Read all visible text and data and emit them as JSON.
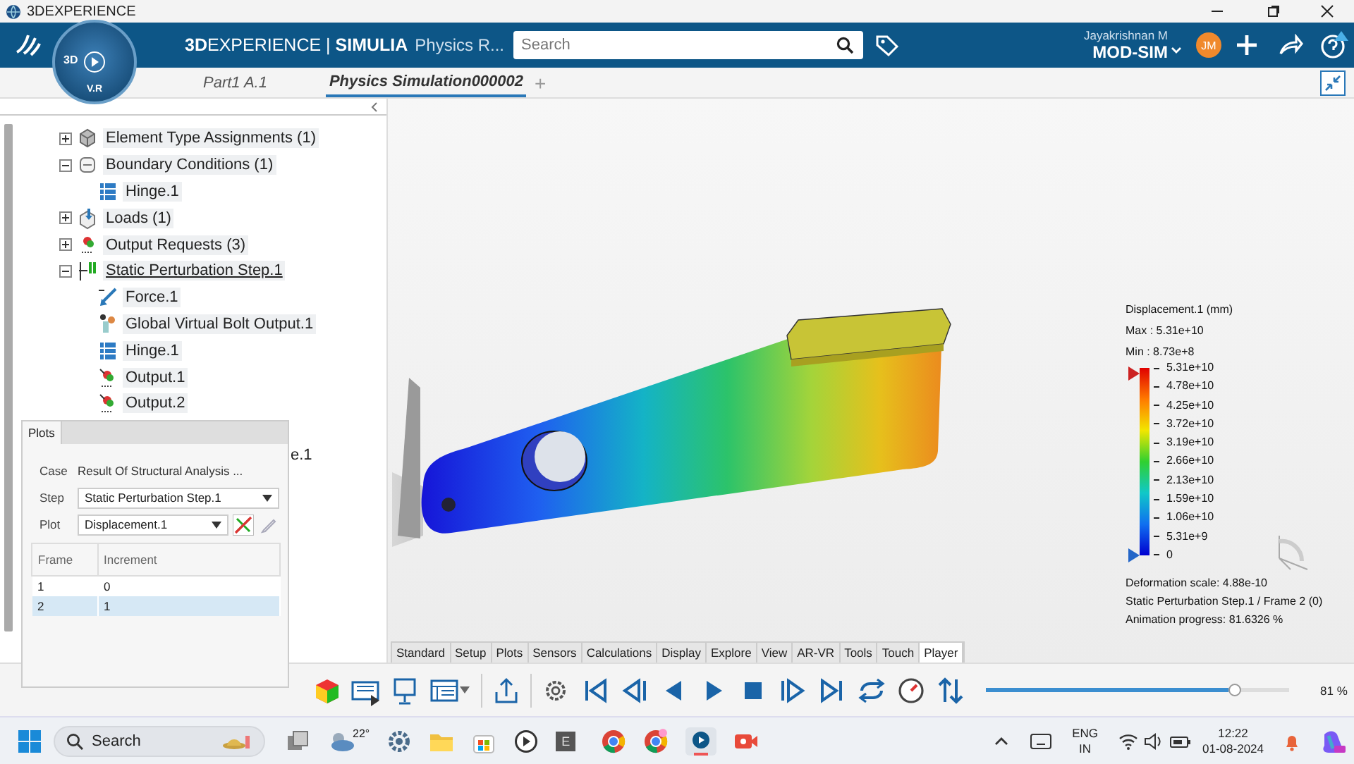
{
  "title_bar": {
    "title": "3DEXPERIENCE"
  },
  "header": {
    "brand": "**3D**EXPERIENCE | **SIMULIA**",
    "app": "Physics R...",
    "search": {
      "placeholder": "Search"
    },
    "user": "Jayakrishnan M",
    "avatar": "JM",
    "tenant": "MOD-SIM"
  },
  "compass": {
    "top": "3D",
    "bottom": "V.R"
  },
  "doc_tabs": [
    {
      "label": "Part1 A.1",
      "selected": false
    },
    {
      "label": "Physics Simulation000002",
      "selected": true
    }
  ],
  "add_tab": "+",
  "tree": [
    {
      "kind": "assignment",
      "label": "Element Type Assignments (1)",
      "expanded": false,
      "active": false
    },
    {
      "kind": "conditions",
      "label": "Boundary Conditions (1)",
      "expanded": true,
      "active": false,
      "children": [
        {
          "kind": "hinge",
          "label": "Hinge.1"
        }
      ]
    },
    {
      "kind": "loads",
      "label": "Loads (1)",
      "expanded": false,
      "active": false
    },
    {
      "kind": "outputs",
      "label": "Output Requests (3)",
      "expanded": false,
      "active": false
    },
    {
      "kind": "step",
      "label": "Static Perturbation Step.1",
      "expanded": true,
      "active": true,
      "children": [
        {
          "kind": "force",
          "label": "Force.1"
        },
        {
          "kind": "bolt",
          "label": "Global Virtual Bolt Output.1"
        },
        {
          "kind": "hinge",
          "label": "Hinge.1"
        },
        {
          "kind": "output",
          "label": "Output.1"
        },
        {
          "kind": "output",
          "label": "Output.2"
        }
      ]
    }
  ],
  "tree_fragment": "e.1",
  "legend": {
    "title": "Displacement.1 (mm)",
    "max": "Max : 5.31e+10",
    "min": "Min : 8.73e+8",
    "ticks": [
      "5.31e+10",
      "4.78e+10",
      "4.25e+10",
      "3.72e+10",
      "3.19e+10",
      "2.66e+10",
      "2.13e+10",
      "1.59e+10",
      "1.06e+10",
      "5.31e+9",
      "0"
    ],
    "footer": [
      "Deformation scale: 4.88e-10",
      "Static Perturbation Step.1 / Frame 2 (0)",
      "Animation progress: 81.6326 %"
    ]
  },
  "plots": {
    "tab": "Plots",
    "fields": [
      {
        "kind": "text",
        "label": "Case",
        "value": "Result Of Structural Analysis ..."
      },
      {
        "kind": "dropdown",
        "label": "Step",
        "value": "Static Perturbation Step.1"
      },
      {
        "kind": "dropdown-tools",
        "label": "Plot",
        "value": "Displacement.1"
      }
    ],
    "columns": [
      "Frame",
      "Increment"
    ],
    "rows": [
      {
        "frame": "1",
        "increment": "0",
        "selected": false
      },
      {
        "frame": "2",
        "increment": "1",
        "selected": true
      }
    ]
  },
  "view_tabs": [
    {
      "label": "Standard",
      "selected": false
    },
    {
      "label": "Setup",
      "selected": false
    },
    {
      "label": "Plots",
      "selected": false
    },
    {
      "label": "Sensors",
      "selected": false
    },
    {
      "label": "Calculations",
      "selected": false
    },
    {
      "label": "Display",
      "selected": false
    },
    {
      "label": "Explore",
      "selected": false
    },
    {
      "label": "View",
      "selected": false
    },
    {
      "label": "AR-VR",
      "selected": false
    },
    {
      "label": "Tools",
      "selected": false
    },
    {
      "label": "Touch",
      "selected": false
    },
    {
      "label": "Player",
      "selected": true
    }
  ],
  "player": {
    "level": 0.8,
    "zoom": "81 %"
  },
  "taskbar": {
    "search": "Search",
    "temperature": "22°",
    "app_letter": "E",
    "language": "ENG",
    "region": "IN",
    "time": "12:22",
    "date": "01-08-2024"
  }
}
